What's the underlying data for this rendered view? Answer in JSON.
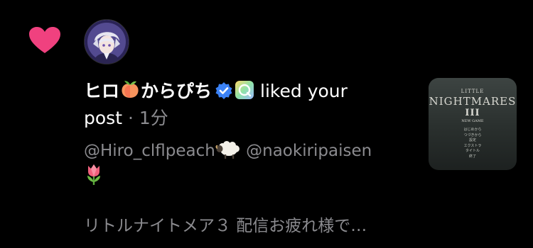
{
  "notification": {
    "type": "like",
    "user": {
      "display_name": "ヒロ",
      "display_name_suffix": "からぴち",
      "name_emoji": "peach-emoji",
      "verified": true,
      "badge": "app-badge-icon"
    },
    "action_text": "liked your",
    "action_text_2": "post",
    "separator": "·",
    "timestamp": "1分",
    "caption": {
      "mention_1": "@Hiro_clflpeach",
      "emoji_1": "sheep-emoji",
      "mention_2": "@naokiripaisen",
      "emoji_2": "tulip-emoji"
    },
    "post_preview": "リトルナイトメア３ 配信お疲れ様で…",
    "thumbnail": {
      "title_small": "LITTLE",
      "title": "NIGHTMARES",
      "numeral": "III",
      "subtitle": "NEW GAME",
      "menu": [
        "はじめから",
        "つづきから",
        "設定",
        "エクストラ",
        "タイトル",
        "終了"
      ]
    }
  },
  "colors": {
    "background": "#000000",
    "heart": "#f0417f",
    "text_primary": "#ffffff",
    "text_secondary": "#8b8b8f",
    "verified": "#3b82f6"
  }
}
